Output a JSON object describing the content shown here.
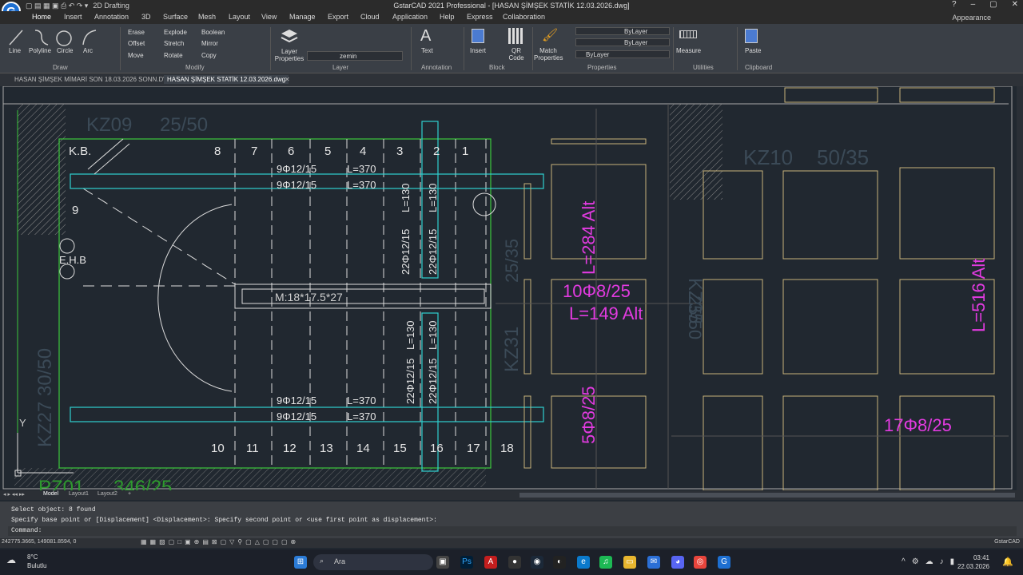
{
  "title_bar": {
    "app_title": "GstarCAD 2021 Professional - [HASAN ŞİMŞEK STATİK 12.03.2026.dwg]",
    "workspace": "2D Drafting",
    "logo_letter": "G"
  },
  "menu_tabs": [
    "Home",
    "Insert",
    "Annotation",
    "3D",
    "Surface",
    "Mesh",
    "Layout",
    "View",
    "Manage",
    "Export",
    "Cloud",
    "Application",
    "Help",
    "Express",
    "Collaboration"
  ],
  "appearance_label": "Appearance",
  "ribbon": {
    "draw_buttons": [
      "Line",
      "Polyline",
      "Circle",
      "Arc"
    ],
    "modify_items": [
      "Erase",
      "Explode",
      "Boolean",
      "Offset",
      "Stretch",
      "Mirror",
      "Move",
      "Rotate",
      "Copy"
    ],
    "layer_properties": "Layer Properties",
    "current_layer": "zemin",
    "annotation_text": "Text",
    "block_insert": "Insert",
    "qr_code": "QR Code",
    "match_properties": "Match Properties",
    "bylayer_1": "ByLayer",
    "bylayer_2": "ByLayer",
    "bylayer_3": "ByLayer",
    "measure": "Measure",
    "paste": "Paste",
    "groups": [
      "Draw",
      "Modify",
      "Layer",
      "Annotation",
      "Block",
      "Properties",
      "Utilities",
      "Clipboard"
    ]
  },
  "doc_tabs": [
    "HASAN ŞİMŞEK MİMARİ SON 18.03.2026 SONN.DWG",
    "HASAN ŞİMŞEK STATİK 12.03.2026.dwg"
  ],
  "drawing": {
    "labels_top_numbers": [
      "8",
      "7",
      "6",
      "5",
      "4",
      "3",
      "2",
      "1"
    ],
    "labels_bottom_numbers": [
      "10",
      "11",
      "12",
      "13",
      "14",
      "15",
      "16",
      "17",
      "18"
    ],
    "kb": "K.B.",
    "ehb": "E.H.B",
    "nine": "9",
    "kz09": "KZ09",
    "kz09_dim": "25/50",
    "kz10": "KZ10",
    "kz10_dim": "50/35",
    "kz27": "KZ27 30/50",
    "kz31": "KZ31",
    "kz35": "KZ35",
    "dim_2535": "25/35",
    "dim_2550": "25/50",
    "pz01": "PZ01",
    "pz01_dim": "346/25",
    "rebar_top_1": "9Φ12/15",
    "rebar_top_2": "9Φ12/15",
    "len_top_1": "L=370",
    "len_top_2": "L=370",
    "rebar_bot_1": "9Φ12/15",
    "rebar_bot_2": "9Φ12/15",
    "len_bot_1": "L=370",
    "len_bot_2": "L=370",
    "vert_1": "22Φ12/15",
    "vert_2": "22Φ12/15",
    "vert_3": "22Φ12/15",
    "vert_4": "22Φ12/15",
    "vlen_1": "L=130",
    "vlen_2": "L=130",
    "vlen_3": "L=130",
    "vlen_4": "L=130",
    "stair": "M:18*17.5*27",
    "mag_1": "L=284 Alt",
    "mag_2": "10Φ8/25",
    "mag_3": "L=149 Alt",
    "mag_4": "5Φ8/25",
    "mag_5": "L=516 Alt",
    "mag_6": "17Φ8/25",
    "ucs_y": "Y"
  },
  "layout_tabs": [
    "Model",
    "Layout1",
    "Layout2",
    "+"
  ],
  "command": {
    "line1": "Select object:  8 found",
    "line2": "Specify base point or [Displacement] <Displacement>: Specify second point or <use first point as displacement>:",
    "line3": "Command:"
  },
  "status": {
    "coords": "242775.3665, 149081.8594, 0",
    "app": "GstarCAD"
  },
  "taskbar": {
    "temp": "8°C",
    "weather": "Bulutlu",
    "search": "Ara",
    "time": "03:41",
    "date": "22.03.2026"
  }
}
